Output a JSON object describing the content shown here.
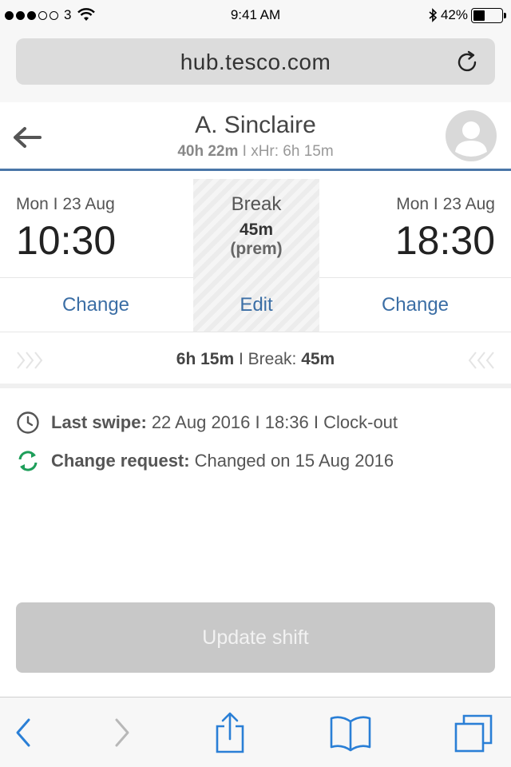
{
  "status_bar": {
    "carrier": "3",
    "time": "9:41 AM",
    "battery_percent": "42%",
    "battery_level": 0.42
  },
  "url_bar": {
    "url": "hub.tesco.com"
  },
  "header": {
    "name": "A. Sinclaire",
    "hours_total": "40h 22m",
    "xhr_text": "I xHr: 6h 15m"
  },
  "shift": {
    "start": {
      "date": "Mon I 23 Aug",
      "time": "10:30",
      "action_label": "Change"
    },
    "break": {
      "label": "Break",
      "value": "45m",
      "note": "(prem)",
      "action_label": "Edit"
    },
    "end": {
      "date": "Mon I 23 Aug",
      "time": "18:30",
      "action_label": "Change"
    },
    "summary": {
      "duration": "6h 15m",
      "separator": " I Break: ",
      "break": "45m"
    }
  },
  "info": {
    "last_swipe_label": "Last swipe:",
    "last_swipe_value": "22 Aug 2016 I 18:36 I Clock-out",
    "change_request_label": "Change request:",
    "change_request_value": "Changed on 15 Aug 2016"
  },
  "update_button": {
    "label": "Update shift"
  },
  "colors": {
    "accent": "#4a76a8",
    "link": "#3b6ea5",
    "ios_blue": "#2a7fd6",
    "green": "#1e9e5a"
  }
}
